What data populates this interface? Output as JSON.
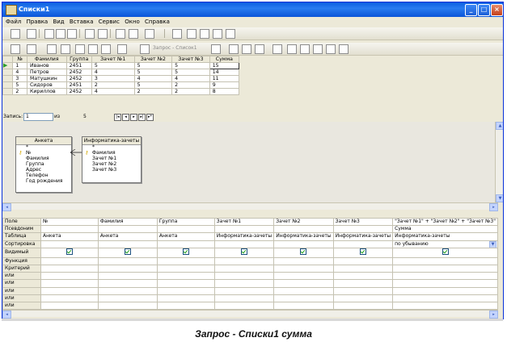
{
  "window": {
    "title": "Списки1",
    "controls": {
      "minimize": "_",
      "maximize": "□",
      "close": "×"
    }
  },
  "menu": [
    "Файл",
    "Правка",
    "Вид",
    "Вставка",
    "Сервис",
    "Окно",
    "Справка"
  ],
  "toolbar2": {
    "filter_text": "Запрос - Список1"
  },
  "datasheet": {
    "columns": [
      "№",
      "Фамилия",
      "Группа",
      "Зачет №1",
      "Зачет №2",
      "Зачет №3",
      "Сумма"
    ],
    "rows": [
      [
        "1",
        "Иванов",
        "2451",
        "5",
        "5",
        "5",
        "15"
      ],
      [
        "4",
        "Петров",
        "2452",
        "4",
        "5",
        "5",
        "14"
      ],
      [
        "3",
        "Матушкин",
        "2452",
        "3",
        "4",
        "4",
        "11"
      ],
      [
        "5",
        "Сидоров",
        "2451",
        "2",
        "5",
        "2",
        "9"
      ],
      [
        "2",
        "Кириллов",
        "2452",
        "4",
        "2",
        "2",
        "8"
      ]
    ],
    "record_label": "Запись:",
    "record_current": "1",
    "record_of_label": "из",
    "record_total": "5"
  },
  "tables": [
    {
      "caption": "Анкета",
      "star": "*",
      "fields": [
        "№",
        "Фамилия",
        "Группа",
        "Адрес",
        "Телефон",
        "Год рождения"
      ],
      "key_field": "№"
    },
    {
      "caption": "Информатика-зачеты",
      "star": "*",
      "fields": [
        "Фамилия",
        "Зачет №1",
        "Зачет №2",
        "Зачет №3"
      ],
      "key_field": "Фамилия"
    }
  ],
  "qbe": {
    "row_labels": [
      "Поле",
      "Псевдоним",
      "Таблица",
      "Сортировка",
      "Видимый",
      "Функция",
      "Критерий",
      "или",
      "или",
      "или",
      "или",
      "или"
    ],
    "columns": [
      {
        "field": "№",
        "alias": "",
        "table": "Анкета",
        "sort": "",
        "visible": true
      },
      {
        "field": "Фамилия",
        "alias": "",
        "table": "Анкета",
        "sort": "",
        "visible": true
      },
      {
        "field": "Группа",
        "alias": "",
        "table": "Анкета",
        "sort": "",
        "visible": true
      },
      {
        "field": "Зачет №1",
        "alias": "",
        "table": "Информатика-зачеты",
        "sort": "",
        "visible": true
      },
      {
        "field": "Зачет №2",
        "alias": "",
        "table": "Информатика-зачеты",
        "sort": "",
        "visible": true
      },
      {
        "field": "Зачет №3",
        "alias": "",
        "table": "Информатика-зачеты",
        "sort": "",
        "visible": true
      },
      {
        "field": "\"Зачет №1\" + \"Зачет №2\" + \"Зачет №3\"",
        "alias": "Сумма",
        "table": "Информатика-зачеты",
        "sort": "по убыванию",
        "visible": true
      }
    ]
  },
  "caption": "Запрос - Списки1 сумма"
}
